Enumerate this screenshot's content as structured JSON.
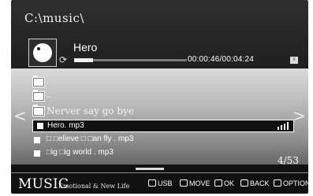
{
  "header": {
    "path": "C:\\music\\"
  },
  "now_playing": {
    "title": "Hero",
    "time": "00:00:46/00:04:24",
    "progress_fraction": 0.17
  },
  "list": {
    "items": [
      {
        "type": "folder",
        "label": "."
      },
      {
        "type": "folder",
        "label": ".."
      },
      {
        "type": "folder",
        "label": "Nerver say go bye"
      },
      {
        "type": "file",
        "label": "Hero. mp3",
        "selected": true
      },
      {
        "type": "file",
        "label": "□ □elieve □ □an fly . mp3"
      },
      {
        "type": "file",
        "label": "□ig □ig world . mp3"
      }
    ],
    "counter": "4/53",
    "nav": {
      "left": "<",
      "right": ">"
    }
  },
  "footer": {
    "mode": "MUSIC",
    "category": "Emotional & New Life",
    "hints": {
      "usb": "USB",
      "move": "MOVE",
      "ok": "OK",
      "back": "BACK",
      "option": "OPTION"
    }
  }
}
